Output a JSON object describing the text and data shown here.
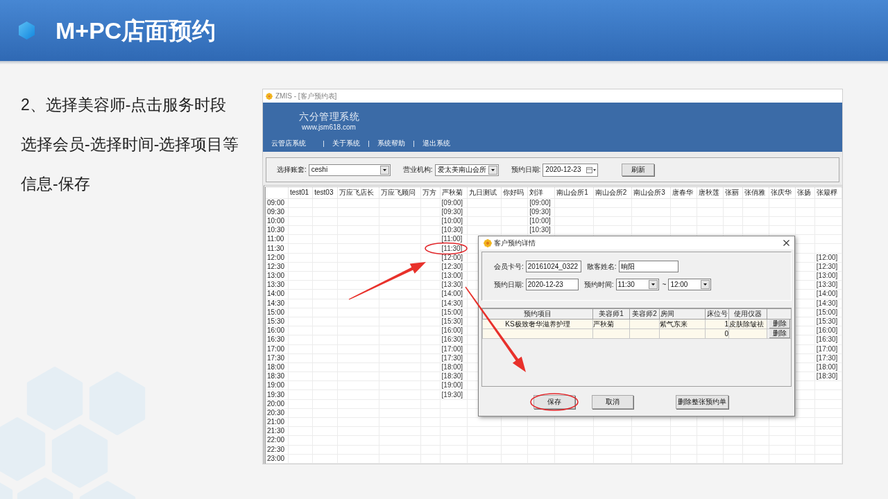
{
  "slide": {
    "title": "M+PC店面预约",
    "instructions": [
      "2、选择美容师-点击服务时段",
      "选择会员-选择时间-选择项目等",
      "信息-保存"
    ]
  },
  "app": {
    "window_title": "ZMIS - [客户预约表]",
    "banner": {
      "name": "六分管理系统",
      "url": "www.jsm618.com"
    },
    "menu": [
      "云管店系统",
      "关于系统",
      "系统帮助",
      "退出系统"
    ],
    "toolbar": {
      "fields": [
        {
          "label": "选择账套:",
          "value": "ceshi",
          "kind": "combo"
        },
        {
          "label": "营业机构:",
          "value": "爱太美南山会所",
          "kind": "combo"
        },
        {
          "label": "预约日期:",
          "value": "2020-12-23",
          "kind": "date"
        }
      ],
      "button": "刷新"
    },
    "schedule": {
      "times": [
        "09:00",
        "09:30",
        "10:00",
        "10:30",
        "11:00",
        "11:30",
        "12:00",
        "12:30",
        "13:00",
        "13:30",
        "14:00",
        "14:30",
        "15:00",
        "15:30",
        "16:00",
        "16:30",
        "17:00",
        "17:30",
        "18:00",
        "18:30",
        "19:00",
        "19:30",
        "20:00",
        "20:30",
        "21:00",
        "21:30",
        "22:00",
        "22:30",
        "23:00"
      ],
      "columns": [
        {
          "name": "test01"
        },
        {
          "name": "test03"
        },
        {
          "name": "万应飞店长"
        },
        {
          "name": "万应飞顾问"
        },
        {
          "name": "万方"
        },
        {
          "name": "严秋菊",
          "slots": [
            {
              "kind": "time",
              "text": "[09:00]"
            },
            {
              "kind": "time",
              "text": "[09:30]"
            },
            {
              "kind": "time",
              "text": "[10:00]"
            },
            {
              "kind": "time",
              "text": "[10:30]"
            },
            {
              "kind": "time",
              "text": "[11:00]"
            },
            {
              "kind": "time",
              "text": "[11:30]"
            },
            {
              "kind": "time",
              "text": "[12:00]"
            },
            {
              "kind": "time",
              "text": "[12:30]"
            },
            {
              "kind": "time",
              "text": "[13:00]"
            },
            {
              "kind": "time",
              "text": "[13:30]"
            },
            {
              "kind": "time",
              "text": "[14:00]"
            },
            {
              "kind": "time",
              "text": "[14:30]"
            },
            {
              "kind": "time",
              "text": "[15:00]"
            },
            {
              "kind": "time",
              "text": "[15:30]"
            },
            {
              "kind": "time",
              "text": "[16:00]"
            },
            {
              "kind": "time",
              "text": "[16:30]"
            },
            {
              "kind": "time",
              "text": "[17:00]"
            },
            {
              "kind": "time",
              "text": "[17:30]"
            },
            {
              "kind": "time",
              "text": "[18:00]"
            },
            {
              "kind": "time",
              "text": "[18:30]"
            },
            {
              "kind": "time",
              "text": "[19:00]"
            },
            {
              "kind": "time",
              "text": "[19:30]"
            }
          ]
        },
        {
          "name": "九日测试"
        },
        {
          "name": "你好吗"
        },
        {
          "name": "刘洋",
          "slots": [
            {
              "kind": "time",
              "text": "[09:00]"
            },
            {
              "kind": "time",
              "text": "[09:30]"
            },
            {
              "kind": "time",
              "text": "[10:00]"
            },
            {
              "kind": "time",
              "text": "[10:30]"
            }
          ]
        },
        {
          "name": "南山会所1"
        },
        {
          "name": "南山会所2"
        },
        {
          "name": "南山会所3"
        },
        {
          "name": "唐春华"
        },
        {
          "name": "唐秋莲"
        },
        {
          "name": "张丽"
        },
        {
          "name": "张俏雅"
        },
        {
          "name": "张庆华"
        },
        {
          "name": "张扬"
        },
        {
          "name": "张簸桴",
          "slots": [
            {
              "kind": "empty"
            },
            {
              "kind": "empty"
            },
            {
              "kind": "empty"
            },
            {
              "kind": "empty"
            },
            {
              "kind": "empty"
            },
            {
              "kind": "empty"
            },
            {
              "kind": "time",
              "text": "[12:00]"
            },
            {
              "kind": "time",
              "text": "[12:30]"
            },
            {
              "kind": "time",
              "text": "[13:00]"
            },
            {
              "kind": "time",
              "text": "[13:30]"
            },
            {
              "kind": "time",
              "text": "[14:00]"
            },
            {
              "kind": "time",
              "text": "[14:30]"
            },
            {
              "kind": "time",
              "text": "[15:00]"
            },
            {
              "kind": "time",
              "text": "[15:30]"
            },
            {
              "kind": "time",
              "text": "[16:00]"
            },
            {
              "kind": "time",
              "text": "[16:30]"
            },
            {
              "kind": "time",
              "text": "[17:00]"
            },
            {
              "kind": "time",
              "text": "[17:30]"
            },
            {
              "kind": "time",
              "text": "[18:00]"
            },
            {
              "kind": "time",
              "text": "[18:30]"
            }
          ]
        }
      ]
    }
  },
  "dialog": {
    "title": "客户预约详情",
    "form": [
      [
        {
          "label": "会员卡号:",
          "value": "20161024_0322",
          "kind": "text"
        },
        {
          "label": "散客姓名:",
          "value": "晌阳",
          "kind": "text"
        }
      ],
      [
        {
          "label": "预约日期:",
          "value": "2020-12-23",
          "kind": "text"
        },
        {
          "label": "预约时间:",
          "kind": "range",
          "from": "11:30",
          "separator": "~",
          "to": "12:00"
        }
      ]
    ],
    "table": {
      "columns": [
        "预约项目",
        "美容师1",
        "美容师2",
        "房间",
        "床位号",
        "使用仪器"
      ],
      "rows": [
        {
          "item": "KS极致奢华滋养护理",
          "beautician_1": "严秋菊",
          "room": "紫气东来",
          "bed": "1",
          "equipment": "皮肤除皱祛",
          "action": "删除"
        },
        {
          "bed": "0",
          "action": "删除"
        }
      ]
    },
    "buttons": [
      "保存",
      "取消",
      "删除整张预约单"
    ]
  }
}
